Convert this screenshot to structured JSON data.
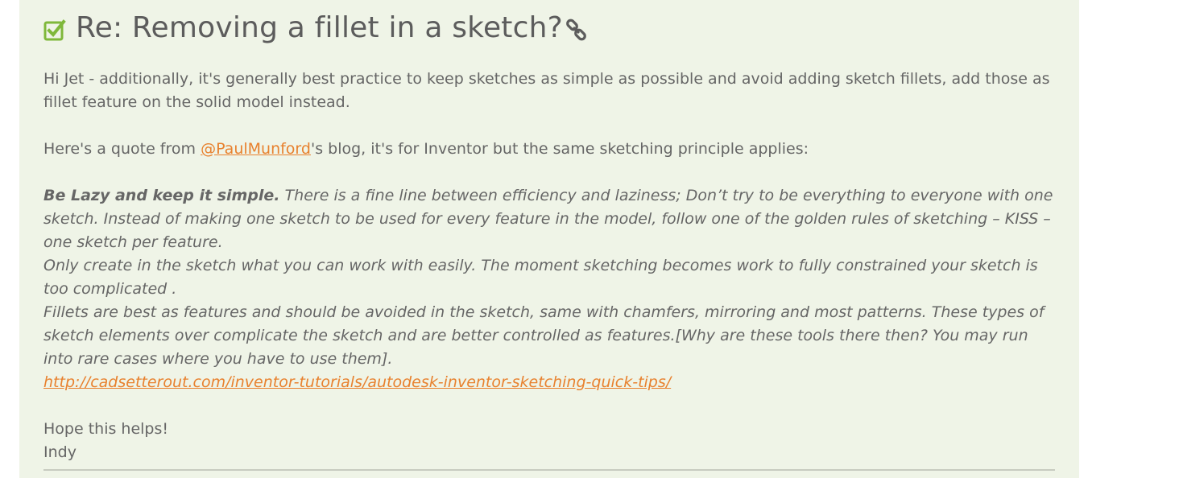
{
  "post": {
    "title": "Re: Removing a fillet in a sketch?",
    "solution_icon": "check-square-icon",
    "permalink_icon": "link-icon",
    "colors": {
      "background": "#eff4e7",
      "text": "#666666",
      "link": "#e8812e",
      "check": "#7fb83b"
    },
    "paragraph1": "Hi Jet - additionally, it's generally best practice to keep sketches as simple as possible and avoid adding sketch fillets, add those as fillet feature on the solid model instead.",
    "quote_intro_before": "Here's a quote from ",
    "mention": "@PaulMunford",
    "quote_intro_after": "'s blog, it's for Inventor but the same sketching principle applies:",
    "quote": {
      "bold_lead": "Be Lazy and keep it simple.",
      "line1_rest": " There is a fine line between efficiency and laziness; Don’t try to be everything to everyone with one sketch. Instead of making one sketch to be used for every feature in the model, follow one of the golden rules of sketching – KISS – one sketch per feature.",
      "line2": "Only create in the sketch what you can work with easily. The moment sketching becomes work to fully constrained your sketch is too complicated .",
      "line3": "Fillets are best as features and should be avoided in the sketch, same with chamfers, mirroring and most patterns. These types of sketch elements over complicate the sketch and are better controlled as features.[Why are these tools there then? You may run into rare cases where you have to use them].",
      "url": "http://cadsetterout.com/inventor-tutorials/autodesk-inventor-sketching-quick-tips/"
    },
    "closing": "Hope this helps!",
    "signature": "Indy"
  }
}
